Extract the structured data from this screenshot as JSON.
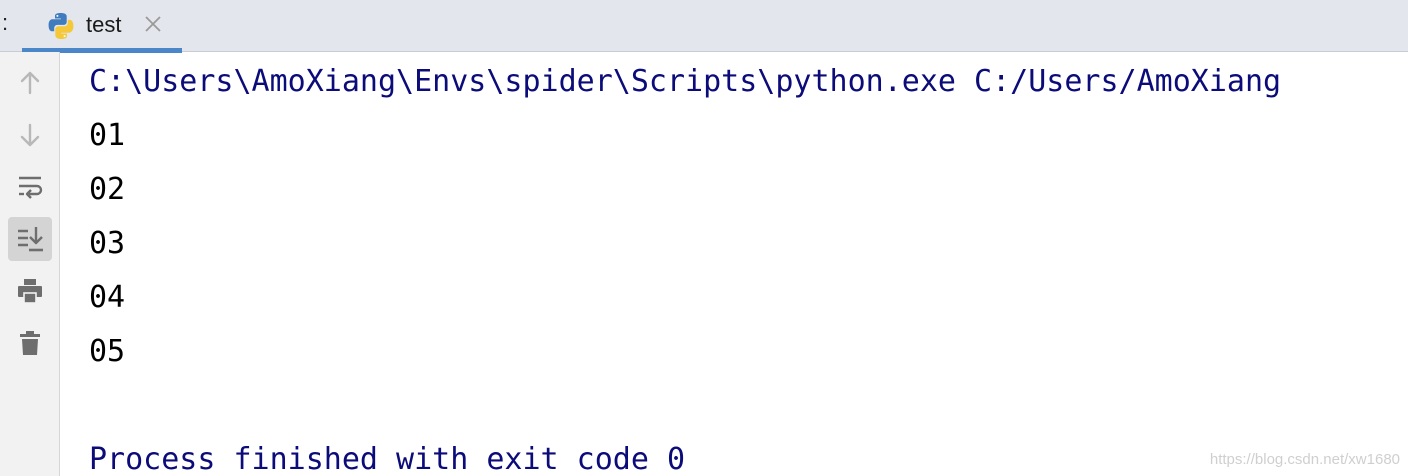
{
  "tabbar": {
    "prefix": ":",
    "tab": {
      "label": "test",
      "icon": "python-icon",
      "close_icon": "close-icon"
    },
    "accent": "#4a86c8"
  },
  "toolbar": {
    "items": [
      {
        "name": "up-arrow-icon"
      },
      {
        "name": "down-arrow-icon"
      },
      {
        "name": "soft-wrap-icon"
      },
      {
        "name": "scroll-to-end-icon",
        "active": true
      },
      {
        "name": "print-icon"
      },
      {
        "name": "trash-icon"
      }
    ]
  },
  "console": {
    "command": "C:\\Users\\AmoXiang\\Envs\\spider\\Scripts\\python.exe C:/Users/AmoXiang",
    "output": [
      "01",
      "02",
      "03",
      "04",
      "05"
    ],
    "process": "Process finished with exit code 0",
    "command_color": "#0b0b7a"
  },
  "watermark": "https://blog.csdn.net/xw1680"
}
